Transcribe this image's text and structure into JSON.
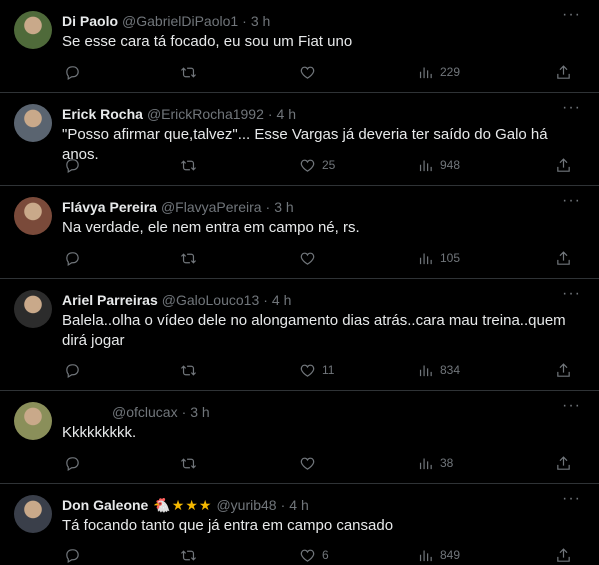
{
  "replies": [
    {
      "name": "Di Paolo",
      "handle": "@GabrielDiPaolo1",
      "time": "3 h",
      "badges": "",
      "text": "Se esse cara tá focado, eu sou um Fiat uno",
      "likes": "",
      "views": "229",
      "avatar_color": "#4f6a3a"
    },
    {
      "name": "Erick Rocha",
      "handle": "@ErickRocha1992",
      "time": "4 h",
      "badges": "",
      "text": "\"Posso afirmar que,talvez\"... Esse Vargas já deveria ter saído do Galo há anos.",
      "likes": "25",
      "views": "948",
      "avatar_color": "#5a6470"
    },
    {
      "name": "Flávya Pereira",
      "handle": "@FlavyaPereira",
      "time": "3 h",
      "badges": "",
      "text": "Na verdade, ele nem entra em campo né, rs.",
      "likes": "",
      "views": "105",
      "avatar_color": "#7a4a3a"
    },
    {
      "name": "Ariel Parreiras",
      "handle": "@GaloLouco13",
      "time": "4 h",
      "badges": "",
      "text": "Balela..olha o vídeo dele no alongamento dias atrás..cara mau treina..quem dirá jogar",
      "likes": "11",
      "views": "834",
      "avatar_color": "#2c2c2c"
    },
    {
      "name": "",
      "handle": "@ofclucax",
      "time": "3 h",
      "badges": "",
      "text": "Kkkkkkkkk.",
      "likes": "",
      "views": "38",
      "avatar_color": "#8a8f5a"
    },
    {
      "name": "Don Galeone",
      "handle": "@yurib48",
      "time": "4 h",
      "badges": "🐔★★★",
      "text": "Tá focando tanto que já entra em campo cansado",
      "likes": "6",
      "views": "849",
      "avatar_color": "#3a3f4a"
    }
  ],
  "colors": {
    "background": "#000000",
    "text": "#e7e9ea",
    "muted": "#71767b",
    "divider": "#2f3336",
    "star": "#f5b800"
  },
  "icons": [
    "reply-icon",
    "retweet-icon",
    "like-icon",
    "views-icon",
    "share-icon",
    "more-icon"
  ],
  "more_label": "···"
}
